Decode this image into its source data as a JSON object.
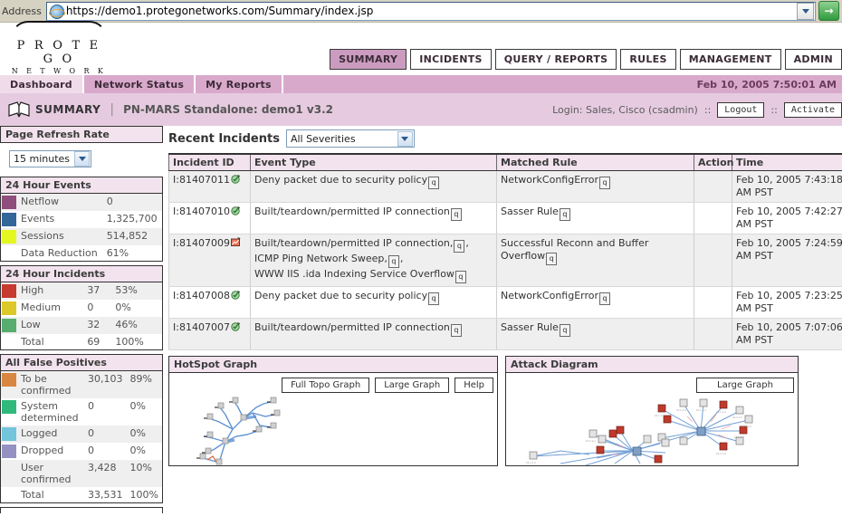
{
  "browser": {
    "address_label": "Address",
    "url": "https://demo1.protegonetworks.com/Summary/index.jsp",
    "go_label": "→"
  },
  "brand": {
    "line1": "P R O T E G O",
    "line2": "N E T W O R K S"
  },
  "nav": {
    "tabs": [
      {
        "label": "SUMMARY",
        "active": true
      },
      {
        "label": "INCIDENTS",
        "active": false
      },
      {
        "label": "QUERY / REPORTS",
        "active": false
      },
      {
        "label": "RULES",
        "active": false
      },
      {
        "label": "MANAGEMENT",
        "active": false
      },
      {
        "label": "ADMIN",
        "active": false
      }
    ]
  },
  "subnav": {
    "tabs": [
      {
        "label": "Dashboard",
        "active": true
      },
      {
        "label": "Network Status",
        "active": false
      },
      {
        "label": "My Reports",
        "active": false
      }
    ],
    "timestamp": "Feb 10, 2005 7:50:01 AM"
  },
  "summary_bar": {
    "title": "SUMMARY",
    "separator": "|",
    "subtitle": "PN-MARS Standalone: demo1 v3.2",
    "login": "Login: Sales, Cisco (csadmin)",
    "sep1": "::",
    "logout_label": "Logout",
    "sep2": "::",
    "activate_label": "Activate"
  },
  "sidebar": {
    "refresh": {
      "header": "Page Refresh Rate",
      "value": "15 minutes"
    },
    "events_panel": {
      "header": "24 Hour Events",
      "rows": [
        {
          "color": "#8f4e7c",
          "label": "Netflow",
          "value": "0",
          "pct": ""
        },
        {
          "color": "#336699",
          "label": "Events",
          "value": "1,325,700",
          "pct": ""
        },
        {
          "color": "#e4f721",
          "label": "Sessions",
          "value": "514,852",
          "pct": ""
        },
        {
          "color": "",
          "label": "Data Reduction",
          "value": "61%",
          "pct": ""
        }
      ]
    },
    "incidents_panel": {
      "header": "24 Hour Incidents",
      "rows": [
        {
          "color": "#c63a2f",
          "label": "High",
          "value": "37",
          "pct": "53%"
        },
        {
          "color": "#ddc82a",
          "label": "Medium",
          "value": "0",
          "pct": "0%"
        },
        {
          "color": "#56ad6e",
          "label": "Low",
          "value": "32",
          "pct": "46%"
        },
        {
          "color": "",
          "label": "Total",
          "value": "69",
          "pct": "100%"
        }
      ]
    },
    "false_positives_panel": {
      "header": "All False Positives",
      "rows": [
        {
          "color": "#d88640",
          "label": "To be confirmed",
          "value": "30,103",
          "pct": "89%"
        },
        {
          "color": "#30b97a",
          "label": "System determined",
          "value": "0",
          "pct": "0%"
        },
        {
          "color": "#72c5db",
          "label": "Logged",
          "value": "0",
          "pct": "0%"
        },
        {
          "color": "#9591c2",
          "label": "Dropped",
          "value": "0",
          "pct": "0%"
        },
        {
          "color": "",
          "label": "User confirmed",
          "value": "3,428",
          "pct": "10%"
        },
        {
          "color": "",
          "label": "Total",
          "value": "33,531",
          "pct": "100%"
        }
      ]
    }
  },
  "recent_incidents": {
    "title": "Recent Incidents",
    "severity_filter": "All Severities",
    "columns": [
      "Incident ID",
      "Event Type",
      "Matched Rule",
      "Action",
      "Time"
    ],
    "rows": [
      {
        "id": "I:81407011",
        "icon": "green-check-icon",
        "events": [
          "Deny packet due to security policy"
        ],
        "rule": "NetworkConfigError",
        "action": "",
        "time": "Feb 10, 2005 7:43:18 AM PST"
      },
      {
        "id": "I:81407010",
        "icon": "green-check-icon",
        "events": [
          "Built/teardown/permitted IP connection"
        ],
        "rule": "Sasser Rule",
        "action": "",
        "time": "Feb 10, 2005 7:42:27 AM PST"
      },
      {
        "id": "I:81407009",
        "icon": "red-chart-icon",
        "events": [
          "Built/teardown/permitted IP connection,",
          "ICMP Ping Network Sweep,",
          "WWW IIS .ida Indexing Service Overflow"
        ],
        "rule": "Successful Reconn and Buffer Overflow",
        "action": "",
        "time": "Feb 10, 2005 7:24:59 AM PST"
      },
      {
        "id": "I:81407008",
        "icon": "green-check-icon",
        "events": [
          "Deny packet due to security policy"
        ],
        "rule": "NetworkConfigError",
        "action": "",
        "time": "Feb 10, 2005 7:23:25 AM PST"
      },
      {
        "id": "I:81407007",
        "icon": "green-check-icon",
        "events": [
          "Built/teardown/permitted IP connection"
        ],
        "rule": "Sasser Rule",
        "action": "",
        "time": "Feb 10, 2005 7:07:06 AM PST"
      }
    ]
  },
  "hotspot_graph": {
    "title": "HotSpot Graph",
    "buttons": [
      "Full Topo Graph",
      "Large Graph",
      "Help"
    ]
  },
  "attack_diagram": {
    "title": "Attack Diagram",
    "buttons": [
      "Large Graph"
    ]
  }
}
